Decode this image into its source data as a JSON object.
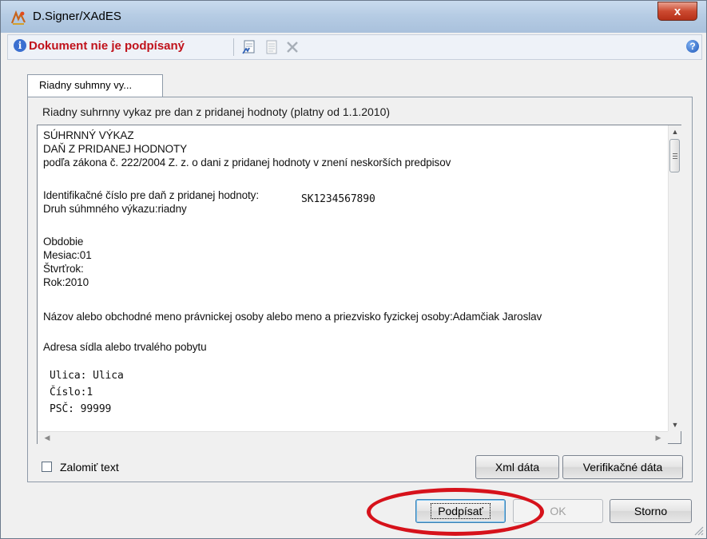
{
  "window": {
    "title": "D.Signer/XAdES",
    "close_label": "x"
  },
  "toolbar": {
    "status_text": "Dokument nie je podpísaný",
    "help_label": "?"
  },
  "tab": {
    "label": "Riadny suhmny vy..."
  },
  "document": {
    "title": "Riadny suhrnny vykaz pre dan z pridanej hodnoty (platny od 1.1.2010)",
    "lines": [
      "SÚHRNNÝ VÝKAZ",
      "DAŇ Z PRIDANEJ HODNOTY",
      "podľa zákona č. 222/2004 Z. z. o dani z pridanej hodnoty v znení neskorších predpisov",
      "Identifikačné číslo pre daň z pridanej hodnoty:",
      "SK1234567890",
      "Druh súhmného výkazu:riadny",
      "Obdobie",
      "Mesiac:01",
      "Štvrťrok:",
      "Rok:2010",
      "Názov alebo obchodné meno právnickej osoby alebo meno a priezvisko fyzickej osoby:Adamčiak Jaroslav",
      "Adresa sídla alebo trvalého pobytu",
      "Ulica: Ulica",
      "Číslo:1",
      "PSČ: 99999"
    ]
  },
  "options": {
    "wrap_text_label": "Zalomiť text",
    "wrap_text_checked": false
  },
  "buttons": {
    "xml_data": "Xml dáta",
    "verification_data": "Verifikačné dáta",
    "sign": "Podpísať",
    "ok": "OK",
    "cancel": "Storno"
  }
}
